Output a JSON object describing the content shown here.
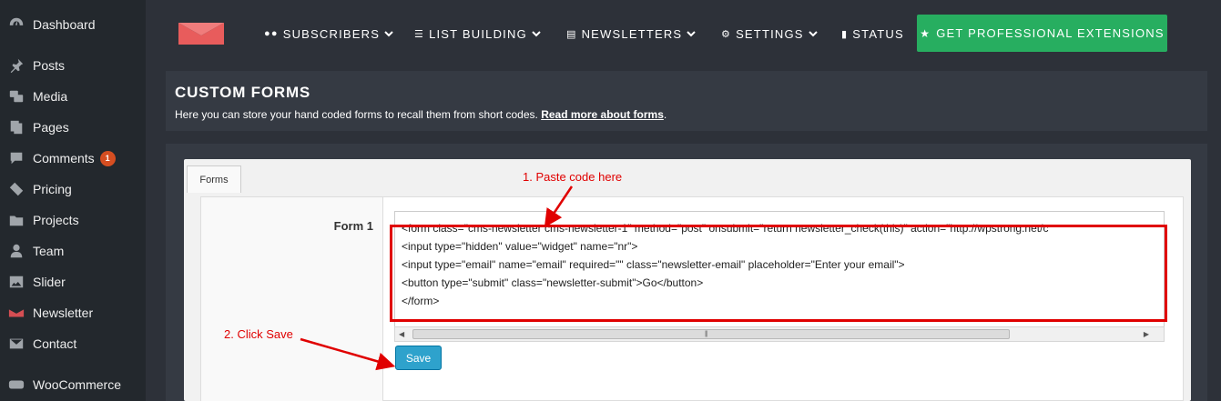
{
  "sidebar": {
    "items": [
      {
        "label": "Dashboard",
        "icon": "dashboard-icon"
      },
      {
        "label": "Posts",
        "icon": "pin-icon"
      },
      {
        "label": "Media",
        "icon": "media-icon"
      },
      {
        "label": "Pages",
        "icon": "pages-icon"
      },
      {
        "label": "Comments",
        "icon": "comment-icon",
        "badge": "1"
      },
      {
        "label": "Pricing",
        "icon": "tag-icon"
      },
      {
        "label": "Projects",
        "icon": "folder-icon"
      },
      {
        "label": "Team",
        "icon": "person-icon"
      },
      {
        "label": "Slider",
        "icon": "image-icon"
      },
      {
        "label": "Newsletter",
        "icon": "newsletter-logo-icon"
      },
      {
        "label": "Contact",
        "icon": "mail-icon"
      },
      {
        "label": "WooCommerce",
        "icon": "woocommerce-icon"
      }
    ]
  },
  "nav": {
    "subscribers": "SUBSCRIBERS",
    "list_building": "LIST BUILDING",
    "newsletters": "NEWSLETTERS",
    "settings": "SETTINGS",
    "status": "STATUS",
    "pro": "GET PROFESSIONAL EXTENSIONS"
  },
  "header": {
    "title": "CUSTOM FORMS",
    "description": "Here you can store your hand coded forms to recall them from short codes. ",
    "link": "Read more about forms",
    "suffix": "."
  },
  "tabs": {
    "forms": "Forms"
  },
  "form": {
    "label": "Form 1",
    "code_lines": [
      "<form class=\"cms-newsletter cms-newsletter-1\" method=\"post\" onsubmit=\"return newsletter_check(this)\" action=\"http://wpstrong.net/c",
      "<input type=\"hidden\" value=\"widget\" name=\"nr\">",
      "<input type=\"email\" name=\"email\" required=\"\" class=\"newsletter-email\" placeholder=\"Enter your email\">",
      "<button type=\"submit\" class=\"newsletter-submit\">Go</button>",
      "</form>"
    ],
    "save": "Save"
  },
  "annotations": {
    "step1": "1. Paste code here",
    "step2": "2. Click Save"
  },
  "colors": {
    "accent_red": "#e00000",
    "pro_green": "#27ae60",
    "save_blue": "#2ea2cc",
    "brand": "#e85c5c"
  }
}
